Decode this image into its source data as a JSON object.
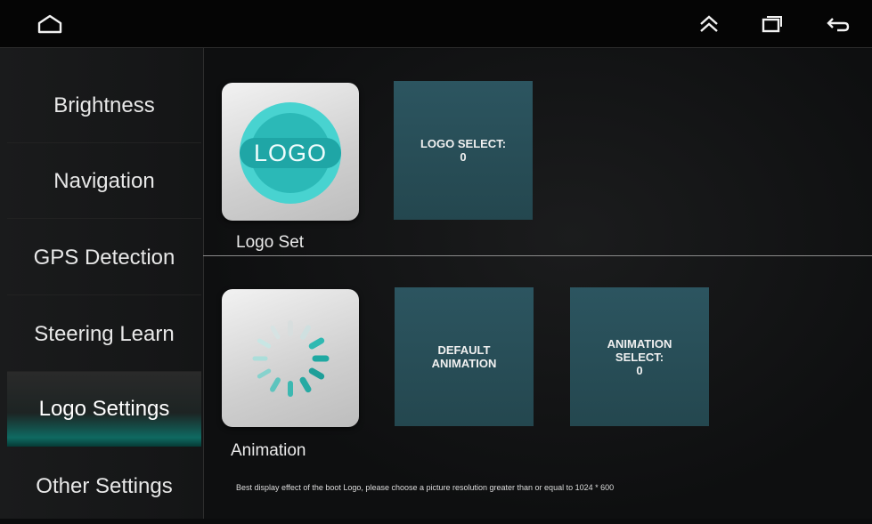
{
  "sidebar": {
    "items": [
      {
        "label": "Brightness"
      },
      {
        "label": "Navigation"
      },
      {
        "label": "GPS Detection"
      },
      {
        "label": "Steering Learn"
      },
      {
        "label": "Logo Settings",
        "active": true
      },
      {
        "label": "Other Settings"
      }
    ]
  },
  "logo_section": {
    "logo_icon_text": "LOGO",
    "label": "Logo Set",
    "select_tile": "LOGO SELECT:\n0"
  },
  "animation_section": {
    "label": "Animation",
    "default_tile": "DEFAULT\nANIMATION",
    "select_tile": "ANIMATION\nSELECT:\n0"
  },
  "footnote": "Best display effect of the boot Logo, please choose a picture resolution greater than or equal to 1024 * 600",
  "colors": {
    "accent_teal": "#0f6a62",
    "tile_teal": "#2c5560",
    "logo_cyan": "#2ec9c6"
  },
  "icons": [
    "home-icon",
    "double-chevron-up-icon",
    "recent-apps-icon",
    "back-icon"
  ]
}
